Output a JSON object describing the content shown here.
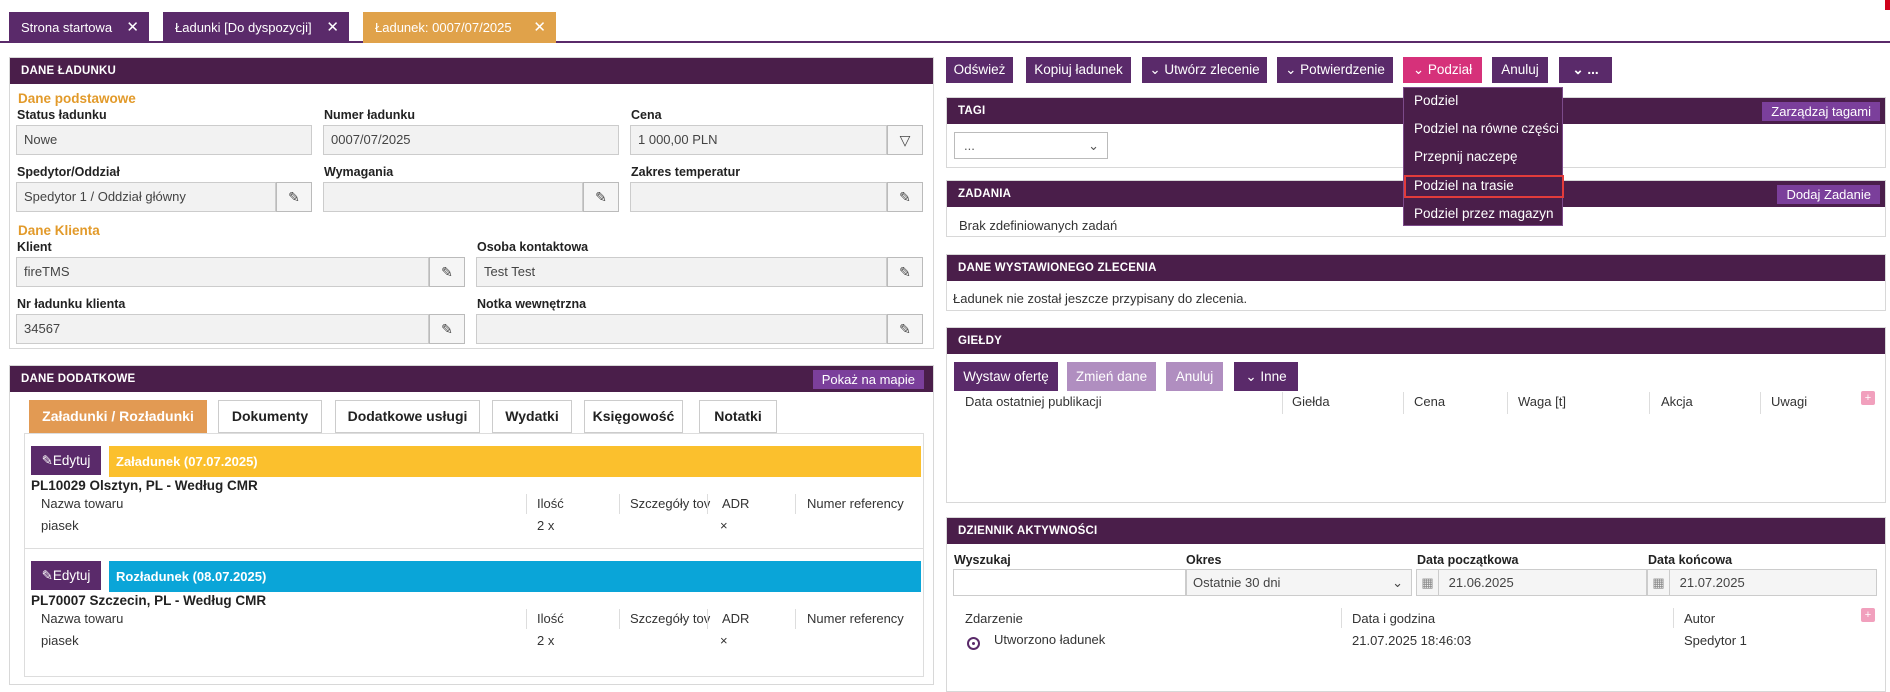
{
  "tabs": [
    {
      "label": "Strona startowa",
      "close": "✕"
    },
    {
      "label": "Ładunki [Do dyspozycji]",
      "close": "✕"
    },
    {
      "label": "Ładunek: 0007/07/2025",
      "close": "✕"
    }
  ],
  "cargo": {
    "title": "DANE ŁADUNKU",
    "basic_section": "Dane podstawowe",
    "status_label": "Status ładunku",
    "status_value": "Nowe",
    "number_label": "Numer ładunku",
    "number_value": "0007/07/2025",
    "price_label": "Cena",
    "price_value": "1 000,00 PLN",
    "forwarder_label": "Spedytor/Oddział",
    "forwarder_value": "Spedytor 1 / Oddział główny",
    "requirements_label": "Wymagania",
    "requirements_value": "",
    "temp_label": "Zakres temperatur",
    "temp_value": "",
    "client_section": "Dane Klienta",
    "client_label": "Klient",
    "client_value": "fireTMS",
    "contact_label": "Osoba kontaktowa",
    "contact_value": "Test Test",
    "client_no_label": "Nr ładunku klienta",
    "client_no_value": "34567",
    "note_label": "Notka wewnętrzna",
    "note_value": ""
  },
  "extra": {
    "title": "DANE DODATKOWE",
    "map_button": "Pokaż na mapie",
    "subtabs": [
      "Załadunki / Rozładunki",
      "Dokumenty",
      "Dodatkowe usługi",
      "Wydatki",
      "Księgowość",
      "Notatki"
    ],
    "edit_label": "Edytuj",
    "columns": [
      "Nazwa towaru",
      "Ilość",
      "Szczegóły tov",
      "ADR",
      "Numer referency"
    ],
    "loading": {
      "title": "Załadunek (07.07.2025)",
      "address": "PL10029 Olsztyn, PL - Według CMR",
      "good": "piasek",
      "qty": "2 x",
      "adr": "×"
    },
    "unloading": {
      "title": "Rozładunek (08.07.2025)",
      "address": "PL70007 Szczecin, PL - Według CMR",
      "good": "piasek",
      "qty": "2 x",
      "adr": "×"
    }
  },
  "toolbar": {
    "refresh": "Odśwież",
    "copy": "Kopiuj ładunek",
    "create_order": "Utwórz zlecenie",
    "confirmation": "Potwierdzenie",
    "split": "Podział",
    "cancel": "Anuluj",
    "more": "..."
  },
  "split_menu": [
    "Podziel",
    "Podziel na równe części",
    "Przepnij naczepę",
    "Podziel na trasie",
    "Podziel przez magazyn"
  ],
  "tags": {
    "title": "TAGI",
    "manage": "Zarządzaj tagami",
    "select_value": "..."
  },
  "tasks": {
    "title": "ZADANIA",
    "add": "Dodaj Zadanie",
    "empty": "Brak zdefiniowanych zadań"
  },
  "order": {
    "title": "DANE WYSTAWIONEGO ZLECENIA",
    "empty": "Ładunek nie został jeszcze przypisany do zlecenia."
  },
  "exchanges": {
    "title": "GIEŁDY",
    "buttons": [
      "Wystaw ofertę",
      "Zmień dane",
      "Anuluj",
      "Inne"
    ],
    "columns": [
      "Data ostatniej publikacji",
      "Giełda",
      "Cena",
      "Waga [t]",
      "Akcja",
      "Uwagi"
    ]
  },
  "log": {
    "title": "DZIENNIK AKTYWNOŚCI",
    "search_label": "Wyszukaj",
    "search_value": "",
    "period_label": "Okres",
    "period_value": "Ostatnie 30 dni",
    "start_label": "Data początkowa",
    "start_value": "21.06.2025",
    "end_label": "Data końcowa",
    "end_value": "21.07.2025",
    "columns": [
      "Zdarzenie",
      "Data i godzina",
      "Autor"
    ],
    "rows": [
      {
        "event": "Utworzono ładunek",
        "datetime": "21.07.2025 18:46:03",
        "author": "Spedytor 1"
      }
    ]
  },
  "colors": {
    "purple_dark": "#4a1e4a",
    "purple": "#5a2a6a",
    "orange": "#e29a53",
    "yellow": "#fbc02d",
    "cyan": "#0aa5d8",
    "pink": "#d6317a"
  }
}
